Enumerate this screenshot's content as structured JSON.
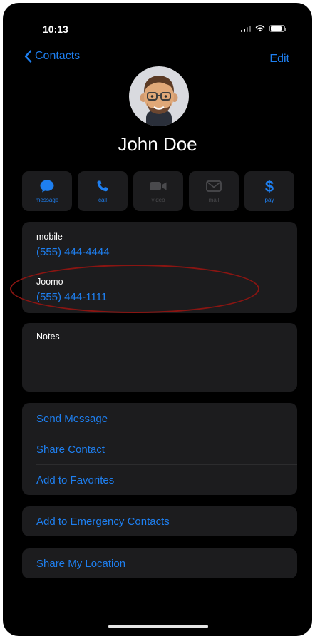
{
  "status_bar": {
    "time": "10:13"
  },
  "nav": {
    "back_label": "Contacts",
    "edit_label": "Edit"
  },
  "contact": {
    "name": "John Doe"
  },
  "actions": [
    {
      "label": "message",
      "icon": "message-bubble-icon",
      "enabled": true
    },
    {
      "label": "call",
      "icon": "phone-icon",
      "enabled": true
    },
    {
      "label": "video",
      "icon": "video-camera-icon",
      "enabled": false
    },
    {
      "label": "mail",
      "icon": "envelope-icon",
      "enabled": false
    },
    {
      "label": "pay",
      "icon": "dollar-icon",
      "enabled": true
    }
  ],
  "phones": [
    {
      "label": "mobile",
      "number": "(555) 444-4444"
    },
    {
      "label": "Joomo",
      "number": "(555) 444-1111"
    }
  ],
  "notes": {
    "label": "Notes"
  },
  "options": [
    "Send Message",
    "Share Contact",
    "Add to Favorites"
  ],
  "emergency": "Add to Emergency Contacts",
  "share_location": "Share My Location",
  "colors": {
    "accent": "#1e7ff0",
    "background": "#000000",
    "card": "#1c1c1e",
    "annotation": "#8a1512"
  }
}
